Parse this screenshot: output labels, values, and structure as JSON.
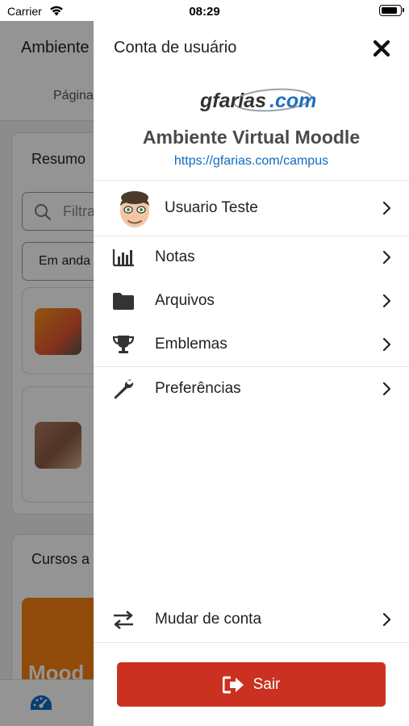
{
  "status_bar": {
    "carrier": "Carrier",
    "time": "08:29",
    "battery_level": 0.9
  },
  "background": {
    "title": "Ambiente",
    "tab": "Página",
    "card1_title": "Resumo",
    "search_placeholder": "Filtra",
    "filter_value": "Em anda",
    "card2_title": "Cursos a",
    "banner_text": "Mood"
  },
  "drawer": {
    "title": "Conta de usuário",
    "logo_text": "gfarias.com",
    "site_name": "Ambiente Virtual Moodle",
    "site_url": "https://gfarias.com/campus",
    "user_name": "Usuario Teste",
    "menu": [
      {
        "label": "Notas",
        "icon": "chart-bar-icon"
      },
      {
        "label": "Arquivos",
        "icon": "folder-icon"
      },
      {
        "label": "Emblemas",
        "icon": "trophy-icon"
      },
      {
        "label": "Preferências",
        "icon": "wrench-icon"
      }
    ],
    "switch_account": "Mudar de conta",
    "logout": "Sair"
  },
  "colors": {
    "logout_bg": "#ca3120",
    "link": "#0f6cbf",
    "moodle_orange": "#f98012"
  }
}
